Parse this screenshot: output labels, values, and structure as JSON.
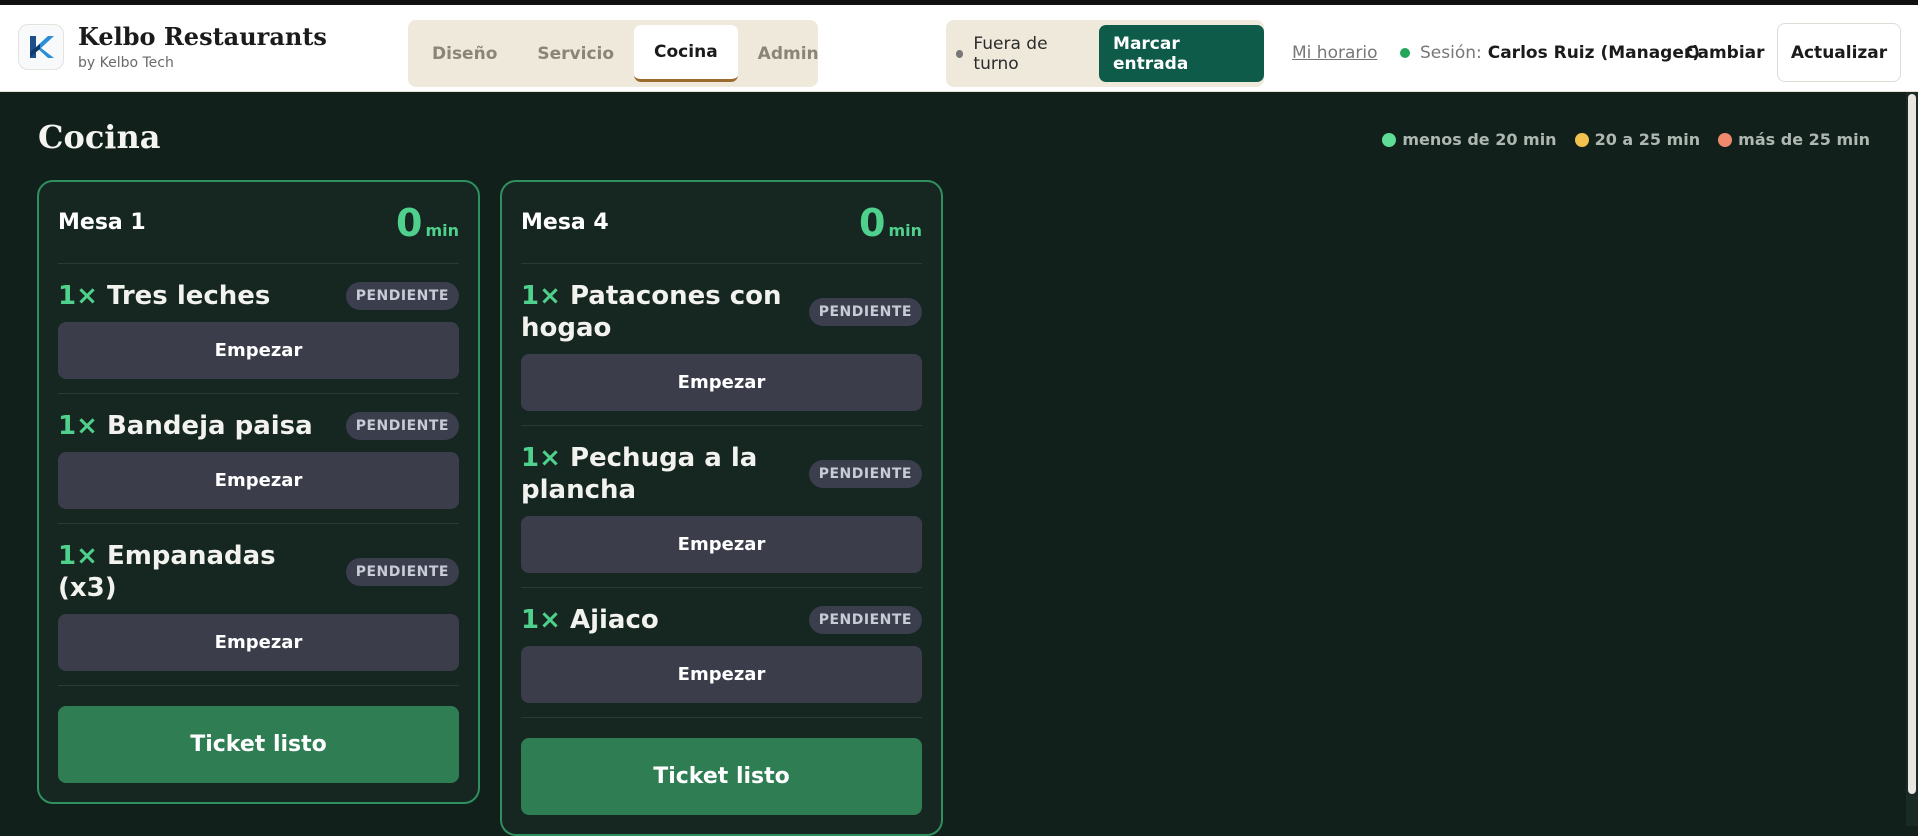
{
  "brand": {
    "title": "Kelbo Restaurants",
    "subtitle": "by Kelbo Tech",
    "logo_icon": "kelbo-k-logo-icon"
  },
  "nav": {
    "tabs": [
      {
        "label": "Diseño",
        "active": false
      },
      {
        "label": "Servicio",
        "active": false
      },
      {
        "label": "Cocina",
        "active": true
      },
      {
        "label": "Admin",
        "active": false
      }
    ]
  },
  "shift": {
    "status": "Fuera de turno",
    "clock_in_label": "Marcar entrada"
  },
  "header": {
    "schedule_link": "Mi horario",
    "session_label": "Sesión:",
    "session_user": "Carlos Ruiz (Manager)",
    "switch_label": "Cambiar",
    "refresh_label": "Actualizar"
  },
  "page": {
    "title": "Cocina"
  },
  "legend": [
    {
      "label": "menos de 20 min",
      "color": "#5fdc95"
    },
    {
      "label": "20 a 25 min",
      "color": "#f2c14e"
    },
    {
      "label": "más de 25 min",
      "color": "#f08a6d"
    }
  ],
  "tickets": [
    {
      "table": "Mesa 1",
      "timer_value": "0",
      "timer_unit": "min",
      "items": [
        {
          "qty": "1×",
          "name": "Tres leches",
          "status": "PENDIENTE",
          "action": "Empezar"
        },
        {
          "qty": "1×",
          "name": "Bandeja paisa",
          "status": "PENDIENTE",
          "action": "Empezar"
        },
        {
          "qty": "1×",
          "name": "Empanadas (x3)",
          "status": "PENDIENTE",
          "action": "Empezar"
        }
      ],
      "ready_label": "Ticket listo"
    },
    {
      "table": "Mesa 4",
      "timer_value": "0",
      "timer_unit": "min",
      "items": [
        {
          "qty": "1×",
          "name": "Patacones con hogao",
          "status": "PENDIENTE",
          "action": "Empezar"
        },
        {
          "qty": "1×",
          "name": "Pechuga a la plancha",
          "status": "PENDIENTE",
          "action": "Empezar"
        },
        {
          "qty": "1×",
          "name": "Ajiaco",
          "status": "PENDIENTE",
          "action": "Empezar"
        }
      ],
      "ready_label": "Ticket listo"
    }
  ],
  "colors": {
    "accent_green": "#2e7d53",
    "timer_green": "#4fd08c",
    "clock_in_bg": "#0f5b4a",
    "background": "#12201b"
  }
}
